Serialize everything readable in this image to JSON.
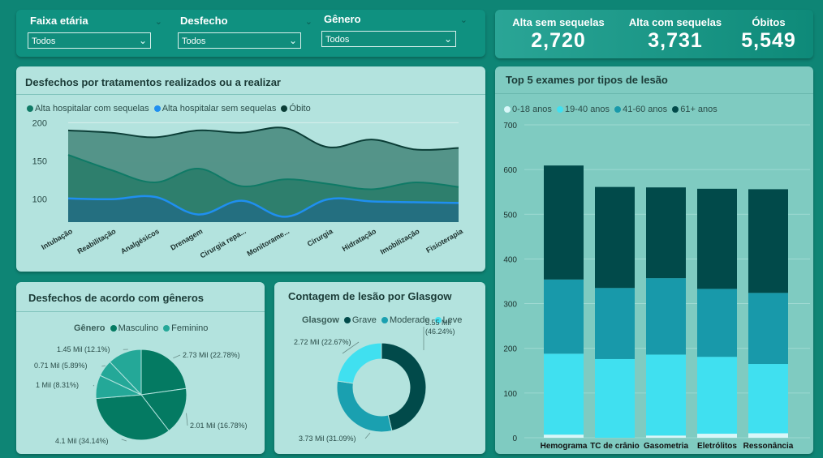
{
  "filters": [
    {
      "label": "Faixa etária",
      "value": "Todos"
    },
    {
      "label": "Desfecho",
      "value": "Todos"
    },
    {
      "label": "Gênero",
      "value": "Todos"
    }
  ],
  "kpis": [
    {
      "label": "Alta sem sequelas",
      "value": "2,720"
    },
    {
      "label": "Alta com sequelas",
      "value": "3,731"
    },
    {
      "label": "Óbitos",
      "value": "5,549"
    }
  ],
  "colors": {
    "obito": "#0b3d36",
    "com_sequelas": "#0f7a66",
    "sem_sequelas": "#1f8ff0",
    "grave": "#014a4a",
    "moderado": "#1aa0b0",
    "leve": "#40e0f0",
    "masculino": "#047a62",
    "feminino": "#24a898",
    "age_0_18": "#d9f7f9",
    "age_19_40": "#40e0f0",
    "age_41_60": "#1899aa",
    "age_61": "#014a4a"
  },
  "area_chart": {
    "title": "Desfechos por tratamentos realizados ou a realizar",
    "legend": [
      "Alta hospitalar com sequelas",
      "Alta hospitalar sem sequelas",
      "Óbito"
    ],
    "y_ticks": [
      "200",
      "150",
      "100"
    ]
  },
  "gender_chart": {
    "title": "Desfechos de acordo com gêneros",
    "legend_title": "Gênero",
    "legend": [
      "Masculino",
      "Feminino"
    ]
  },
  "glasgow_chart": {
    "title": "Contagem de lesão por Glasgow",
    "legend_title": "Glasgow",
    "legend": [
      "Grave",
      "Moderado",
      "Leve"
    ]
  },
  "exams_chart": {
    "title": "Top 5 exames por tipos de lesão",
    "legend": [
      "0-18 anos",
      "19-40 anos",
      "41-60 anos",
      "61+ anos"
    ]
  },
  "chart_data": [
    {
      "type": "area",
      "title": "Desfechos por tratamentos realizados ou a realizar",
      "categories": [
        "Intubação",
        "Reabilitação",
        "Analgésicos",
        "Drenagem",
        "Cirurgia repa...",
        "Monitorame...",
        "Cirurgia",
        "Hidratação",
        "Imobilização",
        "Fisioterapia"
      ],
      "ylim": [
        70,
        210
      ],
      "y_ticks": [
        100,
        150,
        200
      ],
      "series": [
        {
          "name": "Alta hospitalar sem sequelas",
          "values": [
            101,
            100,
            103,
            80,
            98,
            77,
            100,
            97,
            96,
            95
          ]
        },
        {
          "name": "Alta hospitalar com sequelas",
          "values": [
            158,
            138,
            122,
            140,
            117,
            126,
            120,
            113,
            122,
            116
          ]
        },
        {
          "name": "Óbito",
          "values": [
            190,
            187,
            181,
            190,
            187,
            193,
            168,
            178,
            165,
            167
          ]
        }
      ],
      "legend_position": "top-left"
    },
    {
      "type": "pie",
      "title": "Desfechos de acordo com gêneros",
      "slices": [
        {
          "label": "2.73 Mil (22.78%)",
          "value": 22.78,
          "series": "Masculino"
        },
        {
          "label": "2.01 Mil (16.78%)",
          "value": 16.78,
          "series": "Masculino"
        },
        {
          "label": "4.1 Mil (34.14%)",
          "value": 34.14,
          "series": "Masculino"
        },
        {
          "label": "1 Mil (8.31%)",
          "value": 8.31,
          "series": "Feminino"
        },
        {
          "label": "0.71 Mil (5.89%)",
          "value": 5.89,
          "series": "Feminino"
        },
        {
          "label": "1.45 Mil (12.1%)",
          "value": 12.1,
          "series": "Feminino"
        }
      ]
    },
    {
      "type": "pie",
      "title": "Contagem de lesão por Glasgow",
      "slices": [
        {
          "label": "5.55 Mil (46.24%)",
          "value": 46.24,
          "series": "Grave"
        },
        {
          "label": "3.73 Mil (31.09%)",
          "value": 31.09,
          "series": "Moderado"
        },
        {
          "label": "2.72 Mil (22.67%)",
          "value": 22.67,
          "series": "Leve"
        }
      ]
    },
    {
      "type": "bar",
      "title": "Top 5 exames por tipos de lesão",
      "categories": [
        "Hemograma",
        "TC de crânio",
        "Gasometria",
        "Eletrólitos",
        "Ressonância"
      ],
      "ylim": [
        0,
        700
      ],
      "y_ticks": [
        0,
        100,
        200,
        300,
        400,
        500,
        600,
        700
      ],
      "stacked": true,
      "series": [
        {
          "name": "0-18 anos",
          "values": [
            7,
            0,
            5,
            9,
            10
          ]
        },
        {
          "name": "19-40 anos",
          "values": [
            181,
            176,
            181,
            172,
            155
          ]
        },
        {
          "name": "41-60 anos",
          "values": [
            166,
            159,
            171,
            152,
            159
          ]
        },
        {
          "name": "61+ anos",
          "values": [
            255,
            226,
            203,
            224,
            232
          ]
        }
      ],
      "legend_position": "top-left"
    }
  ]
}
